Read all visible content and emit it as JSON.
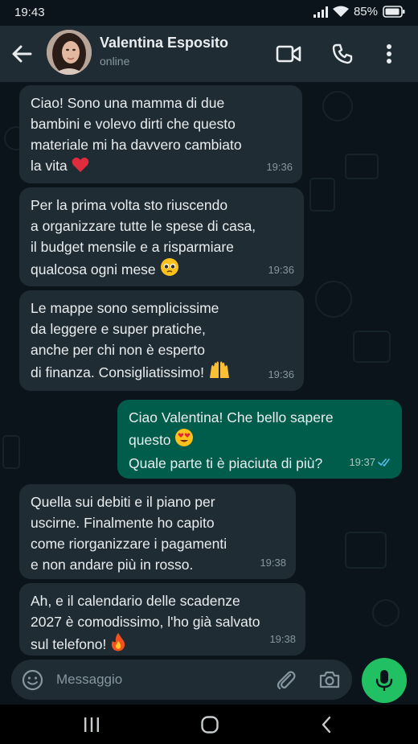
{
  "status_bar": {
    "time": "19:43",
    "battery": "85%"
  },
  "header": {
    "contact_name": "Valentina Esposito",
    "status": "online",
    "icons": [
      "back-arrow-icon",
      "video-call-icon",
      "phone-icon",
      "more-vert-icon"
    ]
  },
  "messages": [
    {
      "direction": "incoming",
      "text": "Ciao! Sono una mamma di due\nbambini e volevo dirti che questo\nmateriale mi ha davvero cambiato\nla vita",
      "emoji": "red-heart",
      "time": "19:36"
    },
    {
      "direction": "incoming",
      "text": "Per la prima volta sto riuscendo\na organizzare tutte le spese di casa,\nil budget mensile e a risparmiare\nqualcosa ogni mese",
      "emoji": "pleading-face",
      "time": "19:36"
    },
    {
      "direction": "incoming",
      "text": "Le mappe sono semplicissime\nda leggere e super pratiche,\nanche per chi non è esperto\ndi finanza. Consigliatissimo!",
      "emoji": "raising-hands",
      "time": "19:36"
    },
    {
      "direction": "outgoing",
      "text_line1": "Ciao Valentina! Che bello sapere",
      "text_line2": "questo",
      "text_line3": "Quale parte ti è piaciuta di più?",
      "emoji": "heart-eyes",
      "time": "19:37",
      "read": true
    },
    {
      "direction": "incoming",
      "text": "Quella sui debiti e il piano per\nuscirne. Finalmente ho capito\ncome riorganizzare i pagamenti\ne non andare più in rosso.",
      "time": "19:38"
    },
    {
      "direction": "incoming",
      "text": "Ah, e il calendario delle scadenze\n2027 è comodissimo, l'ho già salvato\nsul telefono!",
      "emoji": "fire",
      "time": "19:38"
    }
  ],
  "composer": {
    "placeholder": "Messaggio",
    "icons": [
      "emoji-icon",
      "attach-icon",
      "camera-icon",
      "mic-icon"
    ]
  },
  "colors": {
    "background": "#0b141a",
    "header": "#1f2c33",
    "incoming_bubble": "#202c33",
    "outgoing_bubble": "#005c4b",
    "accent_green": "#21c063",
    "read_ticks": "#53bdeb"
  }
}
